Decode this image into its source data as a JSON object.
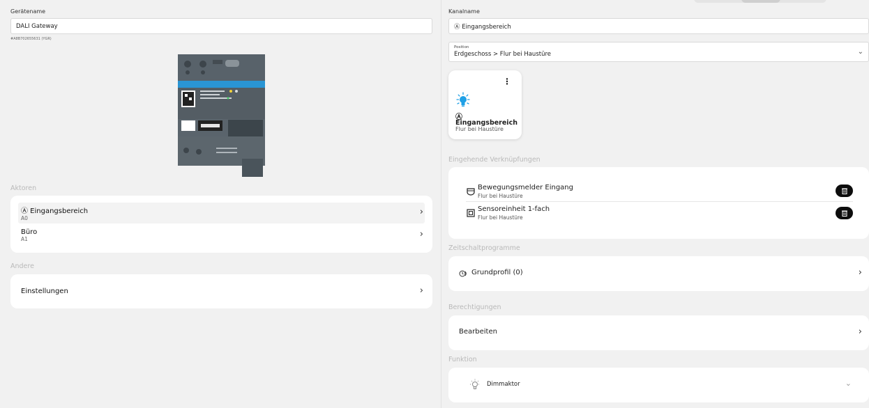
{
  "device": {
    "name_label": "Gerätename",
    "name_value": "DALI Gateway",
    "serial": "#A8B702655631 (YGR)"
  },
  "aktoren": {
    "section": "Aktoren",
    "items": [
      {
        "title": "Ⓐ Eingangsbereich",
        "sub": "A0"
      },
      {
        "title": "Büro",
        "sub": "A1"
      }
    ]
  },
  "andere": {
    "section": "Andere",
    "items": [
      {
        "title": "Einstellungen"
      }
    ]
  },
  "channel": {
    "name_label": "Kanalname",
    "name_value": "Ⓐ Eingangsbereich",
    "position_label": "Position",
    "position_value": "Erdgeschoss > Flur bei Haustüre"
  },
  "tile": {
    "letter": "Ⓐ",
    "title": "Eingangsbereich",
    "sub": "Flur bei Haustüre",
    "icon": "light-bulb-icon"
  },
  "links": {
    "section": "Eingehende Verknüpfungen",
    "items": [
      {
        "title": "Bewegungsmelder Eingang",
        "sub": "Flur bei Haustüre",
        "icon": "motion-sensor-icon"
      },
      {
        "title": "Sensoreinheit 1-fach",
        "sub": "Flur bei Haustüre",
        "icon": "switch-sensor-icon"
      }
    ]
  },
  "schedules": {
    "section": "Zeitschaltprogramme",
    "items": [
      {
        "title": "Grundprofil (0)",
        "icon": "clock-profile-icon"
      }
    ]
  },
  "permissions": {
    "section": "Berechtigungen",
    "items": [
      {
        "title": "Bearbeiten"
      }
    ]
  },
  "function": {
    "section": "Funktion",
    "value": "Dimmaktor",
    "icon": "dimmer-bulb-icon"
  },
  "colors": {
    "background": "#f1f1f1",
    "card": "#ffffff",
    "accent_blue": "#1fa0e6",
    "section_label": "#b9b9b9"
  }
}
